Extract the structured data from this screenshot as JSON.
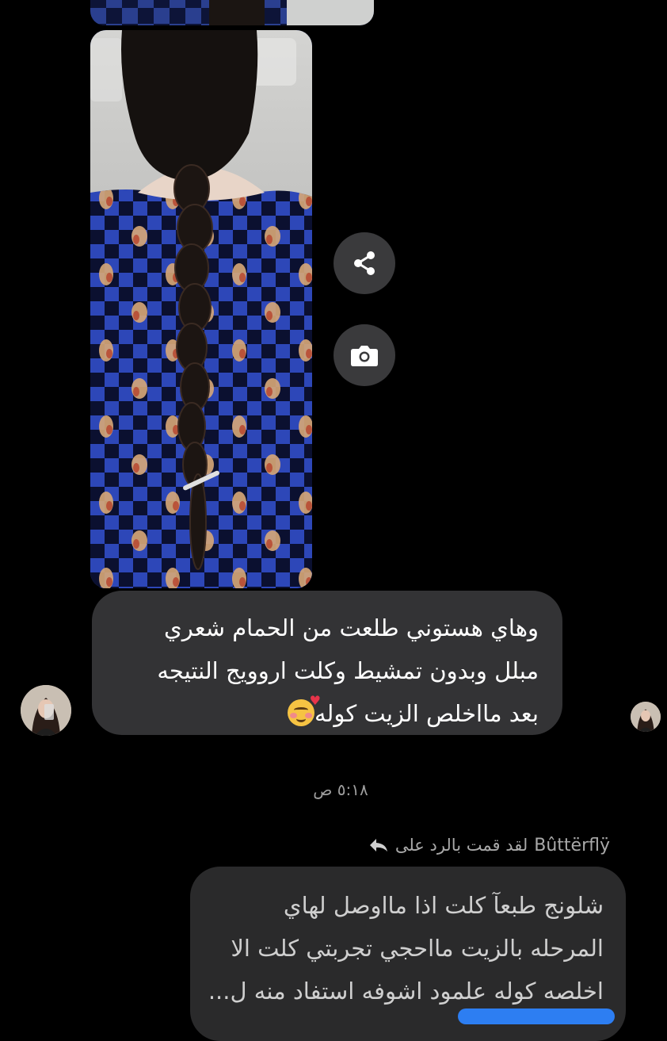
{
  "message_1": {
    "lines": [
      "وهاي هستوني طلعت من الحمام شعري",
      "مبلل وبدون تمشيط وكلت اروويج النتيجه",
      "بعد مااخلص الزيت كوله"
    ],
    "emoji": "smiling-face-with-hearts"
  },
  "timestamp": "٥:١٨ ص",
  "reply": {
    "name": "Bûttërflÿ",
    "text": "لقد قمت بالرد على",
    "icon": "reply-arrow-icon"
  },
  "message_2": {
    "lines": [
      "شلونج طبعآ كلت اذا مااوصل لهاي",
      "المرحله بالزيت مااحجي تجربتي كلت الا",
      "اخلصه كوله علمود اشوفه استفاد منه ل..."
    ]
  },
  "colors": {
    "background": "#000000",
    "bubble": "#333335",
    "action_button": "#3a3a3c",
    "accent_blue": "#2d7ef2"
  }
}
